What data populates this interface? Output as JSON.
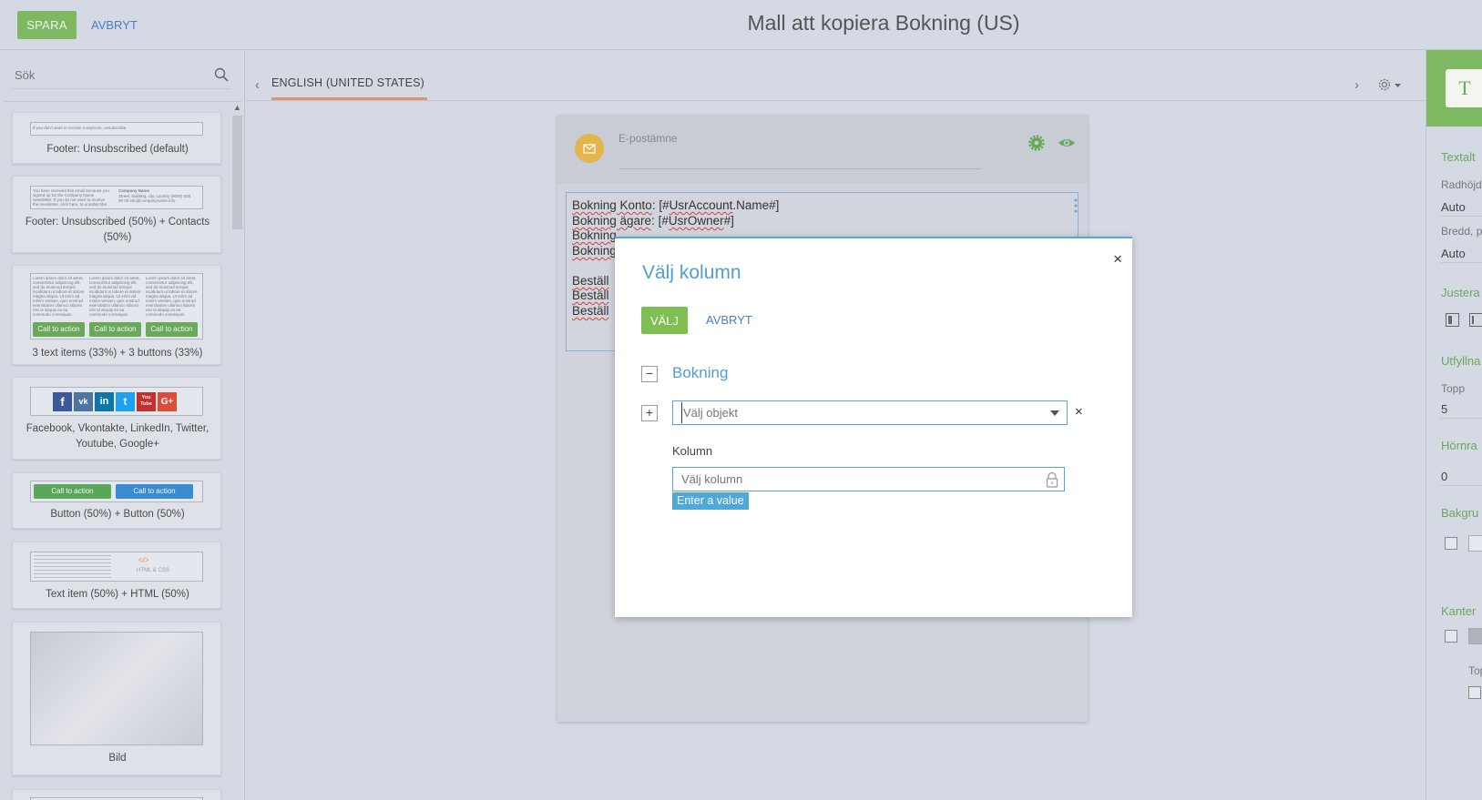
{
  "header": {
    "save_label": "SPARA",
    "cancel_label": "AVBRYT",
    "title": "Mall att kopiera Bokning (US)"
  },
  "left_panel": {
    "search_placeholder": "Sök",
    "templates": [
      {
        "label": "Footer: Unsubscribed (default)",
        "thumb_text": "If you don't want to receive it anymore, unsubscribe"
      },
      {
        "label": "Footer: Unsubscribed (50%) + Contacts (50%)",
        "thumb_left": "You have received this email because you signed up for the Company Name newsletter. If you do not want to receive the newsletter, click here, to unsubscribe.",
        "thumb_right_title": "Company Name",
        "thumb_right": "Street, building, city, country (0000) 000 00 00 info@companyname.info"
      },
      {
        "label": "3 text items (33%) + 3 buttons (33%)",
        "thumb_text": "Lorem ipsum dolor sit amet, consectetur adipiscing elit, sed do eiusmod tempor incididunt ut labore et dolore magna aliqua. Ut enim ad minim veniam, quis nostrud exercitation ullamco laboris nisi ut aliquip ex ea commodo consequat.",
        "cta": "Call to action"
      },
      {
        "label": "Facebook, Vkontakte, LinkedIn, Twitter, Youtube, Google+",
        "icons": [
          "f",
          "vk",
          "in",
          "t",
          "You Tube",
          "G+"
        ]
      },
      {
        "label": "Button (50%) + Button (50%)",
        "cta": "Call to action"
      },
      {
        "label": "Text item (50%) + HTML (50%)",
        "html_mark": "</>",
        "html_text": "HTML & CSS"
      },
      {
        "label": "Bild"
      }
    ]
  },
  "center": {
    "language_tab": "ENGLISH (UNITED STATES)",
    "subject_label": "E-postämne",
    "body_lines": [
      {
        "prefix": "Bokning Konto",
        "rest": ": [#",
        "token": "UsrAccount",
        "tail": ".Name#]"
      },
      {
        "prefix": "Bokning ägare",
        "rest": ": [#",
        "token": "UsrOwner",
        "tail": "#]"
      },
      {
        "prefix": "Bokning"
      },
      {
        "prefix": "Bokning"
      },
      {
        "prefix": "Beställ"
      },
      {
        "prefix": "Beställ"
      },
      {
        "prefix": "Beställ"
      }
    ]
  },
  "modal": {
    "title": "Välj kolumn",
    "select_label": "VÄLJ",
    "cancel_label": "AVBRYT",
    "group_title": "Bokning",
    "object_placeholder": "Välj objekt",
    "column_label": "Kolumn",
    "column_placeholder": "Välj kolumn",
    "validation_message": "Enter a value",
    "close_label": "×",
    "remove_label": "×",
    "collapse_label": "−",
    "expand_label": "+"
  },
  "right_panel": {
    "tool_letter": "T",
    "section_text": "Textalt",
    "line_height_label": "Radhöjd",
    "line_height_value": "Auto",
    "width_label": "Bredd, p",
    "width_value": "Auto",
    "align_title": "Justera",
    "padding_title": "Utfyllna",
    "top_label": "Topp",
    "top_value": "5",
    "corner_title": "Hörnra",
    "corner_value": "0",
    "bg_title": "Bakgru",
    "border_title": "Kanter",
    "border_top_label": "Top"
  },
  "colors": {
    "accent_green": "#7fb862",
    "link_blue": "#4a7ec0",
    "modal_blue": "#4ea8d8",
    "tab_underline": "#e0926a"
  }
}
